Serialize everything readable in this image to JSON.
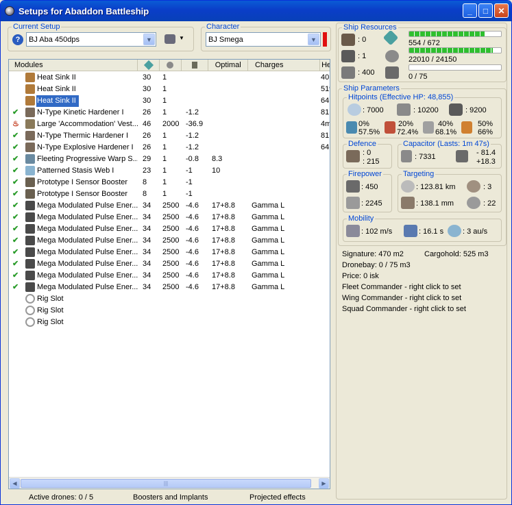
{
  "window": {
    "title": "Setups for Abaddon Battleship"
  },
  "current_setup": {
    "legend": "Current Setup",
    "value": "BJ Aba 450dps"
  },
  "character": {
    "legend": "Character",
    "value": "BJ Smega"
  },
  "grid": {
    "headers": {
      "modules": "Modules",
      "c1": "",
      "c2": "",
      "c3": "",
      "optimal": "Optimal",
      "charges": "Charges",
      "extra": "He"
    },
    "rows": [
      {
        "name": "Heat Sink II",
        "a": "30",
        "b": "1",
        "c": "",
        "opt": "",
        "chg": "",
        "x": "40.",
        "check": "",
        "icon": "#b07a3a"
      },
      {
        "name": "Heat Sink II",
        "a": "30",
        "b": "1",
        "c": "",
        "opt": "",
        "chg": "",
        "x": "51%",
        "check": "",
        "icon": "#b07a3a"
      },
      {
        "name": "Heat Sink II",
        "a": "30",
        "b": "1",
        "c": "",
        "opt": "",
        "chg": "",
        "x": "64.",
        "check": "",
        "icon": "#b07a3a"
      },
      {
        "name": "N-Type Kinetic Hardener I",
        "a": "26",
        "b": "1",
        "c": "-1.2",
        "opt": "",
        "chg": "",
        "x": "81.",
        "check": "✔",
        "icon": "#7a6a5a"
      },
      {
        "name": "Large 'Accommodation' Vest...",
        "a": "46",
        "b": "2000",
        "c": "-36.9",
        "opt": "",
        "chg": "",
        "x": "4m",
        "check": "♨",
        "icon": "#8a7a5a"
      },
      {
        "name": "N-Type Thermic Hardener I",
        "a": "26",
        "b": "1",
        "c": "-1.2",
        "opt": "",
        "chg": "",
        "x": "81.",
        "check": "✔",
        "icon": "#7a6a5a"
      },
      {
        "name": "N-Type Explosive Hardener I",
        "a": "26",
        "b": "1",
        "c": "-1.2",
        "opt": "",
        "chg": "",
        "x": "64.",
        "check": "✔",
        "icon": "#7a6a5a"
      },
      {
        "name": "Fleeting Progressive Warp S...",
        "a": "29",
        "b": "1",
        "c": "-0.8",
        "opt": "8.3",
        "chg": "",
        "x": "",
        "check": "✔",
        "icon": "#6a8aa0"
      },
      {
        "name": "Patterned Stasis Web I",
        "a": "23",
        "b": "1",
        "c": "-1",
        "opt": "10",
        "chg": "",
        "x": "",
        "check": "✔",
        "icon": "#8ab4d0"
      },
      {
        "name": "Prototype I Sensor Booster",
        "a": "8",
        "b": "1",
        "c": "-1",
        "opt": "",
        "chg": "",
        "x": "",
        "check": "✔",
        "icon": "#6a6050"
      },
      {
        "name": "Prototype I Sensor Booster",
        "a": "8",
        "b": "1",
        "c": "-1",
        "opt": "",
        "chg": "",
        "x": "",
        "check": "✔",
        "icon": "#6a6050"
      },
      {
        "name": "Mega Modulated Pulse Ener...",
        "a": "34",
        "b": "2500",
        "c": "-4.6",
        "opt": "17+8.8",
        "chg": "Gamma L",
        "x": "",
        "check": "✔",
        "icon": "#4a4a4a"
      },
      {
        "name": "Mega Modulated Pulse Ener...",
        "a": "34",
        "b": "2500",
        "c": "-4.6",
        "opt": "17+8.8",
        "chg": "Gamma L",
        "x": "",
        "check": "✔",
        "icon": "#4a4a4a"
      },
      {
        "name": "Mega Modulated Pulse Ener...",
        "a": "34",
        "b": "2500",
        "c": "-4.6",
        "opt": "17+8.8",
        "chg": "Gamma L",
        "x": "",
        "check": "✔",
        "icon": "#4a4a4a"
      },
      {
        "name": "Mega Modulated Pulse Ener...",
        "a": "34",
        "b": "2500",
        "c": "-4.6",
        "opt": "17+8.8",
        "chg": "Gamma L",
        "x": "",
        "check": "✔",
        "icon": "#4a4a4a"
      },
      {
        "name": "Mega Modulated Pulse Ener...",
        "a": "34",
        "b": "2500",
        "c": "-4.6",
        "opt": "17+8.8",
        "chg": "Gamma L",
        "x": "",
        "check": "✔",
        "icon": "#4a4a4a"
      },
      {
        "name": "Mega Modulated Pulse Ener...",
        "a": "34",
        "b": "2500",
        "c": "-4.6",
        "opt": "17+8.8",
        "chg": "Gamma L",
        "x": "",
        "check": "✔",
        "icon": "#4a4a4a"
      },
      {
        "name": "Mega Modulated Pulse Ener...",
        "a": "34",
        "b": "2500",
        "c": "-4.6",
        "opt": "17+8.8",
        "chg": "Gamma L",
        "x": "",
        "check": "✔",
        "icon": "#4a4a4a"
      },
      {
        "name": "Mega Modulated Pulse Ener...",
        "a": "34",
        "b": "2500",
        "c": "-4.6",
        "opt": "17+8.8",
        "chg": "Gamma L",
        "x": "",
        "check": "✔",
        "icon": "#4a4a4a"
      },
      {
        "name": "Rig Slot",
        "a": "",
        "b": "",
        "c": "",
        "opt": "",
        "chg": "",
        "x": "",
        "check": "",
        "icon": "ring"
      },
      {
        "name": "Rig Slot",
        "a": "",
        "b": "",
        "c": "",
        "opt": "",
        "chg": "",
        "x": "",
        "check": "",
        "icon": "ring"
      },
      {
        "name": "Rig Slot",
        "a": "",
        "b": "",
        "c": "",
        "opt": "",
        "chg": "",
        "x": "",
        "check": "",
        "icon": "ring"
      }
    ],
    "selected_row": 2
  },
  "status": {
    "drones": "Active drones: 0 / 5",
    "boosters": "Boosters and Implants",
    "projected": "Projected effects"
  },
  "resources": {
    "legend": "Ship Resources",
    "turrets": ": 0",
    "launchers": ": 1",
    "calibration": ": 400",
    "cpu": "554 / 672",
    "cpu_fill": 0.82,
    "power": "22010 / 24150",
    "power_fill": 0.91,
    "drone_bw": "0 / 75",
    "drone_fill": 0
  },
  "params": {
    "legend": "Ship Parameters"
  },
  "hitpoints": {
    "legend": "Hitpoints (Effective HP: 48,855)",
    "shield": ": 7000",
    "armor": ": 10200",
    "structure": ": 9200",
    "res": [
      {
        "a": "0%",
        "b": "57.5%"
      },
      {
        "a": "20%",
        "b": "72.4%"
      },
      {
        "a": "40%",
        "b": "68.1%"
      },
      {
        "a": "50%",
        "b": "66%"
      }
    ]
  },
  "defence": {
    "legend": "Defence",
    "a": ": 0",
    "b": ": 215"
  },
  "capacitor": {
    "legend": "Capacitor (Lasts: 1m 47s)",
    "amount": ": 7331",
    "delta1": "- 81.4",
    "delta2": "+18.3"
  },
  "firepower": {
    "legend": "Firepower",
    "dps": ": 450",
    "volley": ": 2245"
  },
  "targeting": {
    "legend": "Targeting",
    "range": ": 123.81 km",
    "targets": ": 3",
    "res": ": 138.1 mm",
    "scan": ": 22"
  },
  "mobility": {
    "legend": "Mobility",
    "speed": ": 102 m/s",
    "align": ": 16.1 s",
    "warp": ": 3 au/s"
  },
  "misc": {
    "signature": "Signature: 470 m2",
    "cargo": "Cargohold: 525 m3",
    "dronebay": "Dronebay: 0 / 75 m3",
    "price": "Price: 0 isk",
    "fleet": "Fleet Commander - right click to set",
    "wing": "Wing Commander - right click to set",
    "squad": "Squad Commander - right click to set"
  },
  "colors": {
    "accent": "#0046d5",
    "selection": "#316ac5",
    "character_flag": "#e01010"
  }
}
